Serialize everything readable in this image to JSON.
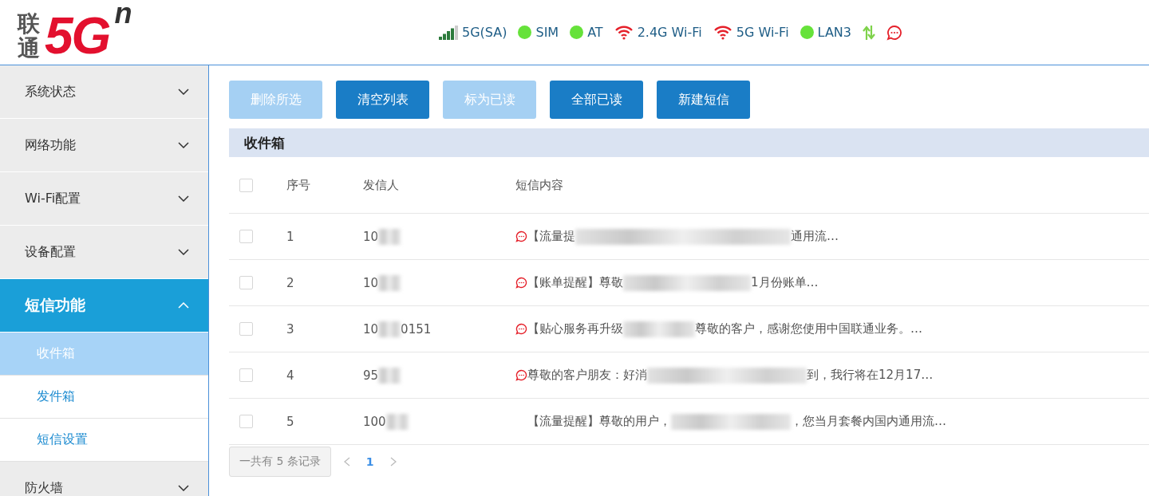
{
  "logo": {
    "brand": "联通",
    "mark": "5G",
    "superscript": "n"
  },
  "status": [
    {
      "kind": "signal",
      "label": "5G(SA)"
    },
    {
      "kind": "dot",
      "label": "SIM",
      "color": "#66e23a"
    },
    {
      "kind": "dot",
      "label": "AT",
      "color": "#66e23a"
    },
    {
      "kind": "wifi",
      "label": "2.4G Wi-Fi"
    },
    {
      "kind": "wifi",
      "label": "5G Wi-Fi"
    },
    {
      "kind": "dot",
      "label": "LAN3",
      "color": "#66e23a"
    },
    {
      "kind": "transfer"
    },
    {
      "kind": "message"
    }
  ],
  "sidebar": {
    "items": [
      {
        "label": "系统状态",
        "expanded": false,
        "selected": false
      },
      {
        "label": "网络功能",
        "expanded": false,
        "selected": false
      },
      {
        "label": "Wi-Fi配置",
        "expanded": false,
        "selected": false
      },
      {
        "label": "设备配置",
        "expanded": false,
        "selected": false
      },
      {
        "label": "短信功能",
        "expanded": true,
        "selected": true,
        "children": [
          {
            "label": "收件箱",
            "selected": true
          },
          {
            "label": "发件箱",
            "selected": false
          },
          {
            "label": "短信设置",
            "selected": false
          }
        ]
      },
      {
        "label": "防火墙",
        "expanded": false,
        "selected": false
      }
    ]
  },
  "toolbar": [
    {
      "label": "删除所选",
      "disabled": true
    },
    {
      "label": "清空列表",
      "disabled": false
    },
    {
      "label": "标为已读",
      "disabled": true
    },
    {
      "label": "全部已读",
      "disabled": false
    },
    {
      "label": "新建短信",
      "disabled": false
    }
  ],
  "inbox": {
    "title": "收件箱",
    "columns": [
      "序号",
      "发信人",
      "短信内容"
    ],
    "select_all_checked": false,
    "rows": [
      {
        "index": "1",
        "sender_start": "10",
        "sender_end": "",
        "content_start": "【流量提",
        "content_end": "通用流…",
        "unread": true,
        "checked": false
      },
      {
        "index": "2",
        "sender_start": "10",
        "sender_end": "",
        "content_start": "【账单提醒】尊敬",
        "content_end": "1月份账单…",
        "unread": true,
        "checked": false
      },
      {
        "index": "3",
        "sender_start": "10",
        "sender_end": "0151",
        "content_start": "【贴心服务再升级",
        "content_end": "尊敬的客户，感谢您使用中国联通业务。…",
        "unread": true,
        "checked": false
      },
      {
        "index": "4",
        "sender_start": "95",
        "sender_end": "",
        "content_start": "尊敬的客户朋友：好消",
        "content_end": "到，我行将在12月17…",
        "unread": true,
        "checked": false
      },
      {
        "index": "5",
        "sender_start": "100",
        "sender_end": "",
        "content_start": "【流量提醒】尊敬的用户，",
        "content_end": "，您当月套餐内国内通用流…",
        "unread": false,
        "checked": false
      }
    ]
  },
  "pagination": {
    "summary": "一共有 5 条记录",
    "pages": [
      {
        "label": "1",
        "selected": true
      }
    ]
  }
}
